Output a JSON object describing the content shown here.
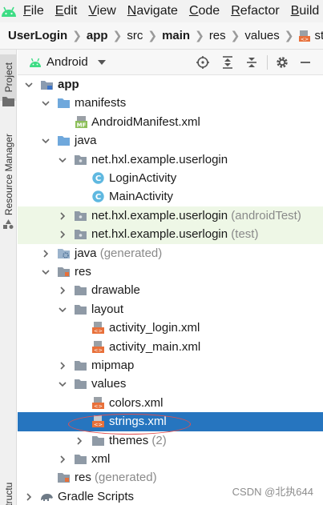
{
  "menu": {
    "items": [
      "File",
      "Edit",
      "View",
      "Navigate",
      "Code",
      "Refactor",
      "Build"
    ]
  },
  "breadcrumb": {
    "items": [
      "UserLogin",
      "app",
      "src",
      "main",
      "res",
      "values",
      "strings.xml"
    ]
  },
  "left_strip": {
    "project_tab": "Project",
    "resource_manager_tab": "Resource Manager",
    "structure_tab": "Structure"
  },
  "project_view": {
    "view_mode": "Android"
  },
  "tree": {
    "app": "app",
    "manifests": "manifests",
    "android_manifest": "AndroidManifest.xml",
    "manifest_badge": "MF",
    "java": "java",
    "pkg_main": "net.hxl.example.userlogin",
    "login_activity": "LoginActivity",
    "main_activity": "MainActivity",
    "class_badge": "C",
    "pkg_android_test": "net.hxl.example.userlogin",
    "android_test_suffix": "(androidTest)",
    "pkg_test": "net.hxl.example.userlogin",
    "test_suffix": "(test)",
    "java_generated": "java",
    "generated_suffix": "(generated)",
    "res": "res",
    "drawable": "drawable",
    "layout": "layout",
    "activity_login": "activity_login.xml",
    "activity_main": "activity_main.xml",
    "mipmap": "mipmap",
    "values": "values",
    "colors": "colors.xml",
    "strings": "strings.xml",
    "themes": "themes",
    "themes_count": "(2)",
    "xml": "xml",
    "res_generated": "res",
    "res_generated_suffix": "(generated)",
    "gradle_scripts": "Gradle Scripts"
  },
  "watermark": "CSDN @北执644",
  "colors": {
    "selection": "#2675bf",
    "test_highlight": "#eef7e6",
    "annotation_ellipse": "#e05050",
    "android_green": "#3ddc84"
  }
}
